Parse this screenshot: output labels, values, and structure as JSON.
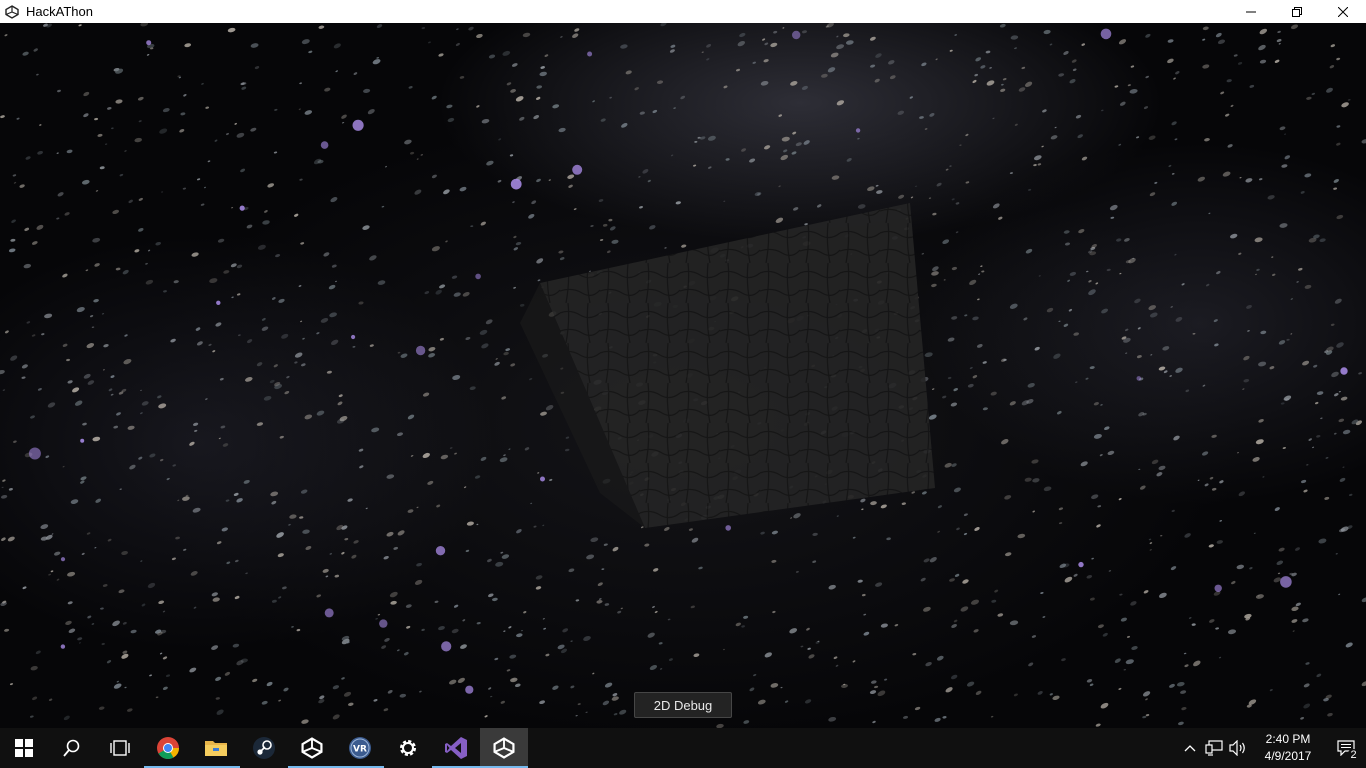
{
  "window": {
    "title": "HackAThon",
    "app_icon": "unity-icon",
    "controls": [
      "minimize-icon",
      "restore-icon",
      "close-icon"
    ]
  },
  "scene": {
    "debug_button_label": "2D Debug"
  },
  "taskbar": {
    "apps": [
      {
        "name": "start-button",
        "icon": "windows-logo-icon",
        "running": false,
        "active": false
      },
      {
        "name": "search-button",
        "icon": "search-icon",
        "running": false,
        "active": false
      },
      {
        "name": "task-view-button",
        "icon": "task-view-icon",
        "running": false,
        "active": false
      },
      {
        "name": "chrome-button",
        "icon": "chrome-icon",
        "running": true,
        "active": false
      },
      {
        "name": "file-explorer-button",
        "icon": "folder-icon",
        "running": true,
        "active": false
      },
      {
        "name": "steam-button",
        "icon": "steam-icon",
        "running": false,
        "active": false
      },
      {
        "name": "unity-button",
        "icon": "unity-icon",
        "running": true,
        "active": false
      },
      {
        "name": "steamvr-button",
        "icon": "vr-icon",
        "running": true,
        "active": false
      },
      {
        "name": "settings-button",
        "icon": "gear-icon",
        "running": false,
        "active": false
      },
      {
        "name": "visual-studio-button",
        "icon": "visual-studio-icon",
        "running": true,
        "active": false
      },
      {
        "name": "unity-game-button",
        "icon": "unity-icon",
        "running": true,
        "active": true
      }
    ],
    "tray": {
      "icons": [
        "chevron-up-icon",
        "network-icon",
        "volume-icon"
      ],
      "time": "2:40 PM",
      "date": "4/9/2017",
      "notification_count": "2"
    },
    "colors": {
      "running_indicator": "#76b9ed",
      "background": "#101010"
    }
  }
}
